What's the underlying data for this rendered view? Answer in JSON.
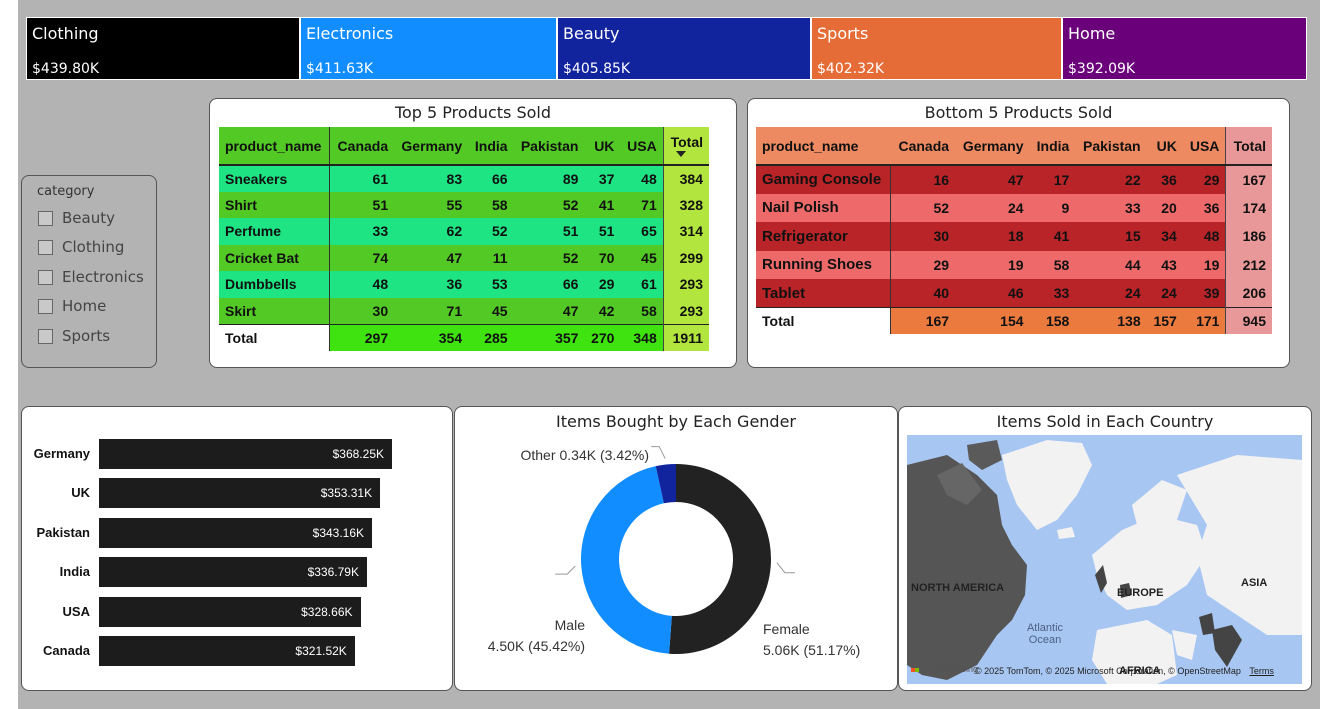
{
  "kpis": [
    {
      "name": "Clothing",
      "value": "$439.80K",
      "color": "#000000"
    },
    {
      "name": "Electronics",
      "value": "$411.63K",
      "color": "#118dff"
    },
    {
      "name": "Beauty",
      "value": "$405.85K",
      "color": "#12239e"
    },
    {
      "name": "Sports",
      "value": "$402.32K",
      "color": "#e66c37"
    },
    {
      "name": "Home",
      "value": "$392.09K",
      "color": "#6b007b"
    }
  ],
  "slicer": {
    "title": "category",
    "options": [
      "Beauty",
      "Clothing",
      "Electronics",
      "Home",
      "Sports"
    ]
  },
  "top_table": {
    "title": "Top 5 Products Sold",
    "headers": [
      "product_name",
      "Canada",
      "Germany",
      "India",
      "Pakistan",
      "UK",
      "USA",
      "Total"
    ],
    "rows": [
      [
        "Sneakers",
        "61",
        "83",
        "66",
        "89",
        "37",
        "48",
        "384"
      ],
      [
        "Shirt",
        "51",
        "55",
        "58",
        "52",
        "41",
        "71",
        "328"
      ],
      [
        "Perfume",
        "33",
        "62",
        "52",
        "51",
        "51",
        "65",
        "314"
      ],
      [
        "Cricket Bat",
        "74",
        "47",
        "11",
        "52",
        "70",
        "45",
        "299"
      ],
      [
        "Dumbbells",
        "48",
        "36",
        "53",
        "66",
        "29",
        "61",
        "293"
      ],
      [
        "Skirt",
        "30",
        "71",
        "45",
        "47",
        "42",
        "58",
        "293"
      ]
    ],
    "total": [
      "Total",
      "297",
      "354",
      "285",
      "357",
      "270",
      "348",
      "1911"
    ]
  },
  "bottom_table": {
    "title": "Bottom 5 Products Sold",
    "headers": [
      "product_name",
      "Canada",
      "Germany",
      "India",
      "Pakistan",
      "UK",
      "USA",
      "Total"
    ],
    "rows": [
      [
        "Gaming Console",
        "16",
        "47",
        "17",
        "22",
        "36",
        "29",
        "167"
      ],
      [
        "Nail Polish",
        "52",
        "24",
        "9",
        "33",
        "20",
        "36",
        "174"
      ],
      [
        "Refrigerator",
        "30",
        "18",
        "41",
        "15",
        "34",
        "48",
        "186"
      ],
      [
        "Running Shoes",
        "29",
        "19",
        "58",
        "44",
        "43",
        "19",
        "212"
      ],
      [
        "Tablet",
        "40",
        "46",
        "33",
        "24",
        "24",
        "39",
        "206"
      ]
    ],
    "total": [
      "Total",
      "167",
      "154",
      "158",
      "138",
      "157",
      "171",
      "945"
    ]
  },
  "chart_data": [
    {
      "type": "bar",
      "orientation": "horizontal",
      "title": "",
      "categories": [
        "Germany",
        "UK",
        "Pakistan",
        "India",
        "USA",
        "Canada"
      ],
      "values": [
        368.25,
        353.31,
        343.16,
        336.79,
        328.66,
        321.52
      ],
      "value_labels": [
        "$368.25K",
        "$353.31K",
        "$343.16K",
        "$336.79K",
        "$328.66K",
        "$321.52K"
      ],
      "xlim": [
        0,
        420
      ],
      "color": "#1c1c1c"
    },
    {
      "type": "pie",
      "variant": "donut",
      "title": "Items Bought by Each Gender",
      "slices": [
        {
          "label": "Female",
          "value": 5.06,
          "value_text": "5.06K (51.17%)",
          "percent": 51.17,
          "color": "#222222"
        },
        {
          "label": "Male",
          "value": 4.5,
          "value_text": "4.50K (45.42%)",
          "percent": 45.42,
          "color": "#118dff"
        },
        {
          "label": "Other",
          "value": 0.34,
          "value_text": "0.34K (3.42%)",
          "percent": 3.42,
          "color": "#12239e"
        }
      ]
    }
  ],
  "map": {
    "title": "Items Sold in Each Country",
    "labels": [
      "NORTH AMERICA",
      "EUROPE",
      "ASIA",
      "AFRICA"
    ],
    "ocean": "Atlantic Ocean",
    "brand": "Microsoft Bing",
    "credit": "© 2025 TomTom, © 2025 Microsoft Corporation, © OpenStreetMap",
    "terms": "Terms"
  }
}
